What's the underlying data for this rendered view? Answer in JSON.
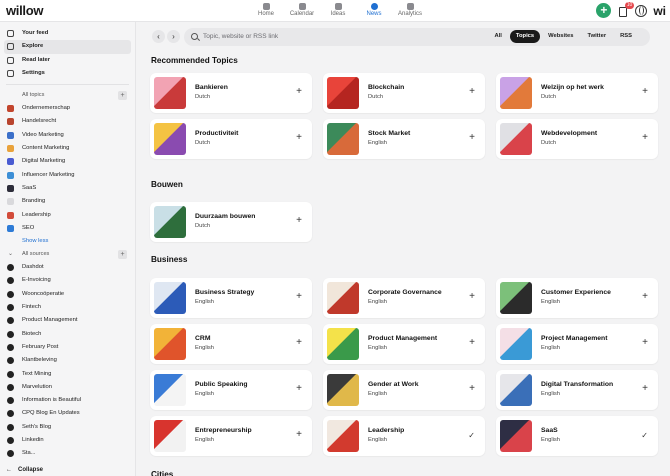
{
  "app": {
    "logo": "willow"
  },
  "topnav": [
    {
      "label": "Home",
      "active": false
    },
    {
      "label": "Calendar",
      "active": false
    },
    {
      "label": "Ideas",
      "active": false
    },
    {
      "label": "News",
      "active": true
    },
    {
      "label": "Analytics",
      "active": false
    }
  ],
  "top_right": {
    "add": "+",
    "notifications_badge": "10",
    "brand_mark": "wi"
  },
  "sidebar": {
    "main": [
      {
        "label": "Your feed",
        "icon": "home-icon",
        "active": false
      },
      {
        "label": "Explore",
        "icon": "compass-icon",
        "active": true
      },
      {
        "label": "Read later",
        "icon": "bookmark-icon",
        "active": false
      },
      {
        "label": "Settings",
        "icon": "gear-icon",
        "active": false
      }
    ],
    "topics_header": "All topics",
    "topics": [
      {
        "label": "Ondernemerschap",
        "color": "#c2452d"
      },
      {
        "label": "Handelsrecht",
        "color": "#b8442e"
      },
      {
        "label": "Video Marketing",
        "color": "#3b6fc9"
      },
      {
        "label": "Content Marketing",
        "color": "#e9a23b"
      },
      {
        "label": "Digital Marketing",
        "color": "#4a5bd1"
      },
      {
        "label": "Influencer Marketing",
        "color": "#3d8fd6"
      },
      {
        "label": "SaaS",
        "color": "#2d2d3a"
      },
      {
        "label": "Branding",
        "color": "#d9d9dc"
      },
      {
        "label": "Leadership",
        "color": "#d24b3a"
      },
      {
        "label": "SEO",
        "color": "#2e7bd6"
      }
    ],
    "show_less": "Show less",
    "sources_header": "All sources",
    "sources": [
      "Dashdot",
      "E-Invoicing",
      "Wooncoöperatie",
      "Fintech",
      "Product Management",
      "Biotech",
      "February Post",
      "Klantbeleving",
      "Text Mining",
      "Marvelution",
      "Information is Beautiful",
      "CPQ Blog En Updates",
      "Seth's Blog",
      "Linkedin",
      "Sta..."
    ],
    "collapse": "Collapse"
  },
  "search": {
    "placeholder": "Topic, website or RSS link",
    "filters": [
      {
        "label": "All",
        "active": false
      },
      {
        "label": "Topics",
        "active": true
      },
      {
        "label": "Websites",
        "active": false
      },
      {
        "label": "Twitter",
        "active": false
      },
      {
        "label": "RSS",
        "active": false
      }
    ]
  },
  "sections": [
    {
      "title": "Recommended Topics",
      "cards": [
        {
          "title": "Bankieren",
          "sub": "Dutch",
          "action": "+",
          "thumb": [
            "#f2a3b3",
            "#c93a3a"
          ]
        },
        {
          "title": "Blockchain",
          "sub": "Dutch",
          "action": "+",
          "thumb": [
            "#e8443a",
            "#b52520"
          ]
        },
        {
          "title": "Welzijn op het werk",
          "sub": "Dutch",
          "action": "+",
          "thumb": [
            "#c9a2e6",
            "#e27a3a"
          ]
        },
        {
          "title": "Productiviteit",
          "sub": "Dutch",
          "action": "+",
          "thumb": [
            "#f4c343",
            "#8a4bb0"
          ]
        },
        {
          "title": "Stock Market",
          "sub": "English",
          "action": "+",
          "thumb": [
            "#3c8a5a",
            "#d86a3a"
          ]
        },
        {
          "title": "Webdevelopment",
          "sub": "Dutch",
          "action": "+",
          "thumb": [
            "#e0e0e4",
            "#d9434a"
          ]
        }
      ]
    },
    {
      "title": "Bouwen",
      "cards": [
        {
          "title": "Duurzaam bouwen",
          "sub": "Dutch",
          "action": "+",
          "thumb": [
            "#c9dfe6",
            "#2e6e3c"
          ]
        }
      ]
    },
    {
      "title": "Business",
      "cards": [
        {
          "title": "Business Strategy",
          "sub": "English",
          "action": "+",
          "thumb": [
            "#dfe7f2",
            "#2c5bb8"
          ]
        },
        {
          "title": "Corporate Governance",
          "sub": "English",
          "action": "+",
          "thumb": [
            "#f1e6da",
            "#c0392b"
          ]
        },
        {
          "title": "Customer Experience",
          "sub": "English",
          "action": "+",
          "thumb": [
            "#7cc07a",
            "#2b2b2b"
          ]
        },
        {
          "title": "CRM",
          "sub": "English",
          "action": "+",
          "thumb": [
            "#f2b338",
            "#e0542b"
          ]
        },
        {
          "title": "Product Management",
          "sub": "English",
          "action": "+",
          "thumb": [
            "#f4e24a",
            "#3a9a4a"
          ]
        },
        {
          "title": "Project Management",
          "sub": "English",
          "action": "+",
          "thumb": [
            "#f4dfe6",
            "#3a9ad6"
          ]
        },
        {
          "title": "Public Speaking",
          "sub": "English",
          "action": "+",
          "thumb": [
            "#3a7bd6",
            "#f4f4f4"
          ]
        },
        {
          "title": "Gender at Work",
          "sub": "English",
          "action": "+",
          "thumb": [
            "#3a3a3a",
            "#e0b84a"
          ]
        },
        {
          "title": "Digital Transformation",
          "sub": "English",
          "action": "+",
          "thumb": [
            "#e6e6ea",
            "#3a6fb8"
          ]
        },
        {
          "title": "Entrepreneurship",
          "sub": "English",
          "action": "+",
          "thumb": [
            "#d8342e",
            "#f2f2f2"
          ]
        },
        {
          "title": "Leadership",
          "sub": "English",
          "action": "✓",
          "thumb": [
            "#f1e8e0",
            "#d23a2e"
          ]
        },
        {
          "title": "SaaS",
          "sub": "English",
          "action": "✓",
          "thumb": [
            "#2e2e44",
            "#d9434a"
          ]
        }
      ]
    },
    {
      "title": "Cities",
      "cards": []
    }
  ]
}
